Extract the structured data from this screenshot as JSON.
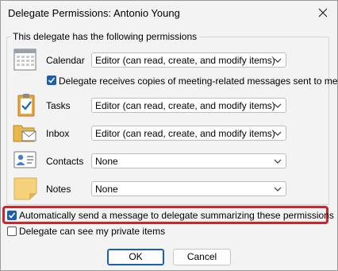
{
  "window": {
    "title": "Delegate Permissions: Antonio Young"
  },
  "group": {
    "caption": "This delegate has the following permissions"
  },
  "permissions": [
    {
      "label": "Calendar",
      "value": "Editor (can read, create, and modify items)",
      "icon": "calendar-icon"
    },
    {
      "label": "Tasks",
      "value": "Editor (can read, create, and modify items)",
      "icon": "tasks-clipboard-icon"
    },
    {
      "label": "Inbox",
      "value": "Editor (can read, create, and modify items)",
      "icon": "inbox-folder-icon"
    },
    {
      "label": "Contacts",
      "value": "None",
      "icon": "contact-card-icon"
    },
    {
      "label": "Notes",
      "value": "None",
      "icon": "sticky-note-icon"
    }
  ],
  "options": {
    "meeting_copies": {
      "label": "Delegate receives copies of meeting-related messages sent to me",
      "checked": true
    },
    "auto_send": {
      "label": "Automatically send a message to delegate summarizing these permissions",
      "checked": true
    },
    "private_items": {
      "label": "Delegate can see my private items",
      "checked": false
    }
  },
  "buttons": {
    "ok": "OK",
    "cancel": "Cancel"
  },
  "colors": {
    "accent": "#1a5fb4",
    "highlight": "#d0242b"
  }
}
